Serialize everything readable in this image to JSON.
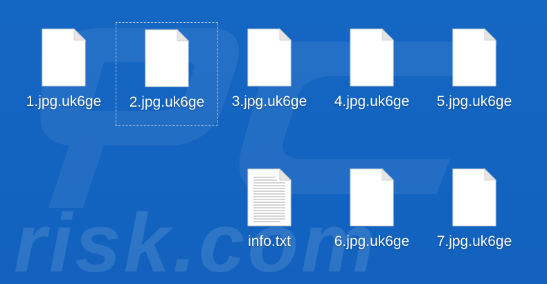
{
  "desktop": {
    "files": [
      {
        "name": "1.jpg.uk6ge",
        "type": "blank",
        "selected": false
      },
      {
        "name": "2.jpg.uk6ge",
        "type": "blank",
        "selected": true
      },
      {
        "name": "3.jpg.uk6ge",
        "type": "blank",
        "selected": false
      },
      {
        "name": "4.jpg.uk6ge",
        "type": "blank",
        "selected": false
      },
      {
        "name": "5.jpg.uk6ge",
        "type": "blank",
        "selected": false
      },
      {
        "name": "info.txt",
        "type": "text",
        "selected": false
      },
      {
        "name": "6.jpg.uk6ge",
        "type": "blank",
        "selected": false
      },
      {
        "name": "7.jpg.uk6ge",
        "type": "blank",
        "selected": false
      }
    ]
  },
  "watermark": {
    "text": "risk.com"
  },
  "colors": {
    "background": "#1565c0",
    "label": "#ffffff",
    "selection": "#c8d8ec"
  }
}
